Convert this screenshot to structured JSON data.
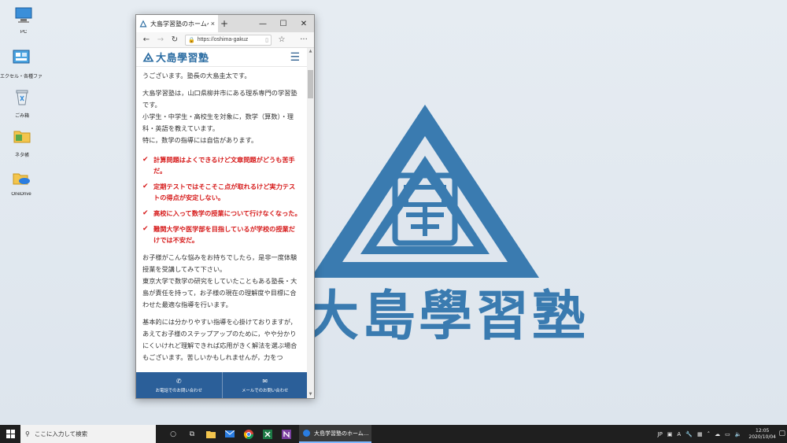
{
  "desktop": {
    "icons": [
      {
        "label": "PC"
      },
      {
        "label": "エクセル・各種ファイル"
      },
      {
        "label": "ごみ箱"
      },
      {
        "label": "ネタ帳"
      },
      {
        "label": "OneDrive"
      }
    ],
    "wallpaper_text": "大島學習塾"
  },
  "browser": {
    "tab_title": "大島学習塾のホームページ",
    "tab_close": "×",
    "new_tab": "+",
    "url": "https://oshima-gakuz",
    "controls": {
      "minimize": "—",
      "maximize": "☐",
      "close": "✕"
    },
    "nav": {
      "back": "←",
      "forward": "→",
      "refresh": "↻",
      "favorite": "☆",
      "more": "···",
      "reading": "▯"
    }
  },
  "site": {
    "logo_text": "大島學習塾",
    "menu_icon": "☰",
    "intro_line": "うございます。塾長の大島圭太です。",
    "paragraph1": "大島学習塾は，山口県柳井市にある理系専門の学習塾です。",
    "paragraph1b": "小学生・中学生・高校生を対象に，数学（算数）・理科・英語を教えています。",
    "paragraph1c": "特に，数学の指導には自信があります。",
    "checklist": [
      "計算問題はよくできるけど文章問題がどうも苦手だ。",
      "定期テストではそこそこ点が取れるけど実力テストの得点が安定しない。",
      "高校に入って数学の授業について行けなくなった。",
      "難関大学や医学部を目指しているが学校の授業だけでは不安だ。"
    ],
    "paragraph2": "お子様がこんな悩みをお持ちでしたら，是非一度体験授業を受講してみて下さい。",
    "paragraph2b": "東京大学で数学の研究をしていたこともある塾長・大島が責任を持って，お子様の現在の理解度や目標に合わせた最適な指導を行います。",
    "paragraph3": "基本的には分かりやすい指導を心掛けておりますが，あえてお子様のステップアップのために，やや分かりにくいけれど理解できれば応用がきく解法を選ぶ場合もございます。苦しいかもしれませんが，力をつ",
    "to_top": "⌃",
    "contact": {
      "phone_label": "お電話でのお問い合わせ",
      "mail_label": "メールでのお問い合わせ"
    }
  },
  "taskbar": {
    "search_placeholder": "ここに入力して検索",
    "active_app": "大島学習塾のホーム...",
    "ime": "JP",
    "ime_mode": "A",
    "time": "12:05",
    "date": "2020/10/04"
  },
  "colors": {
    "brand_blue": "#2d6ea3",
    "check_red": "#d61b1b",
    "contact_bar": "#2b5f99"
  }
}
